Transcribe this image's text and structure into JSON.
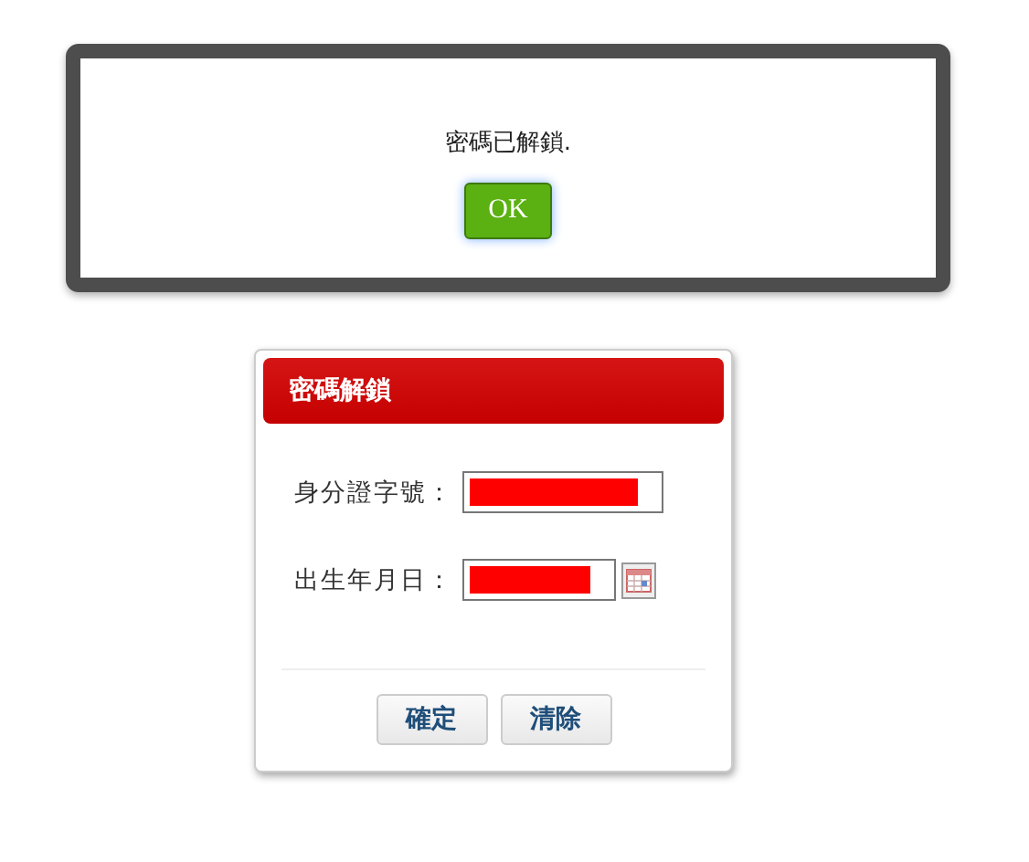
{
  "alert": {
    "message": "密碼已解鎖.",
    "button": "OK"
  },
  "form": {
    "title": "密碼解鎖",
    "fields": [
      {
        "label": "身分證字號：",
        "kind": "text"
      },
      {
        "label": "出生年月日：",
        "kind": "date"
      }
    ],
    "buttons": [
      "確定",
      "清除"
    ]
  }
}
